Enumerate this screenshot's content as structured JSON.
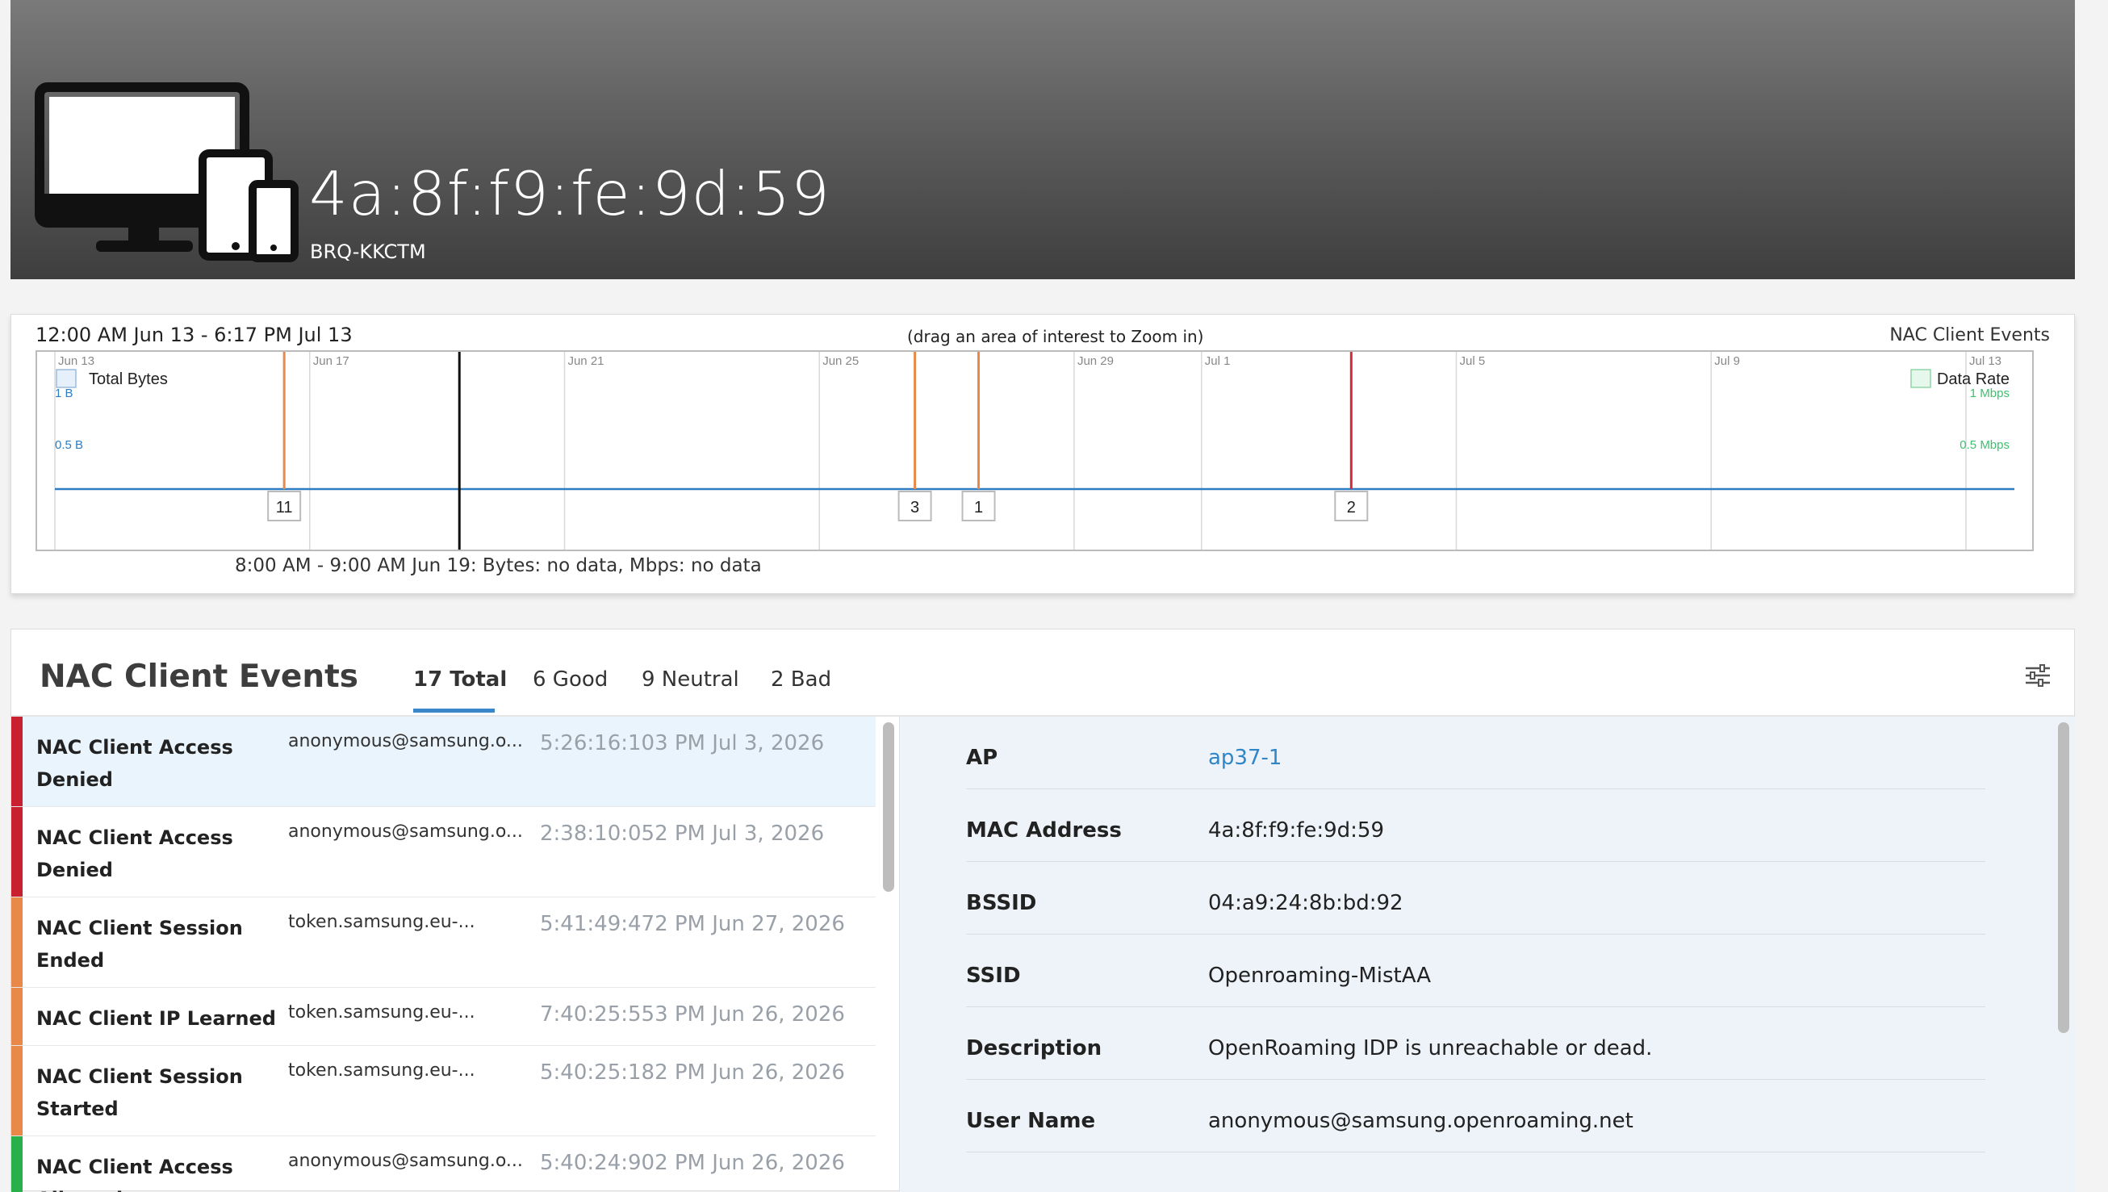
{
  "header": {
    "mac": "4a:8f:f9:fe:9d:59",
    "site": "BRQ-KKCTM"
  },
  "timeline": {
    "range": "12:00 AM Jun 13 - 6:17 PM Jul 13",
    "hint": "(drag an area of interest to Zoom in)",
    "chart_name": "NAC Client Events",
    "hover_readout": "8:00 AM - 9:00 AM Jun 19: Bytes: no data, Mbps: no data"
  },
  "chart_data": {
    "type": "line",
    "x_ticks": [
      "Jun 13",
      "Jun 17",
      "Jun 21",
      "Jun 25",
      "Jun 29",
      "Jul 1",
      "Jul 5",
      "Jul 9",
      "Jul 13"
    ],
    "x_tick_days": [
      0,
      4,
      8,
      12,
      16,
      18,
      22,
      26,
      30
    ],
    "x_range_days": [
      0,
      30.76
    ],
    "series": [
      {
        "name": "Total Bytes",
        "axis": "left",
        "color": "#2e7dc2",
        "values": "no data",
        "level": 0
      },
      {
        "name": "Data Rate",
        "axis": "right",
        "color": "#3fbf6f",
        "values": "no data",
        "level": 0
      }
    ],
    "left_axis": {
      "ticks": [
        "1 B",
        "0.5 B"
      ],
      "color": "#2e7dc2"
    },
    "right_axis": {
      "ticks": [
        "1 Mbps",
        "0.5 Mbps"
      ],
      "color": "#3fbf6f"
    },
    "event_markers": [
      {
        "day": 3.6,
        "count": "11",
        "color": "#e8894a"
      },
      {
        "day": 13.5,
        "count": "3",
        "color": "#e8894a"
      },
      {
        "day": 14.5,
        "count": "1",
        "color": "#e8894a"
      },
      {
        "day": 20.35,
        "count": "2",
        "color": "#d02b3a"
      }
    ],
    "cursor_day": 6.35
  },
  "events": {
    "title": "NAC Client Events",
    "tabs": [
      {
        "label": "17 Total",
        "active": true
      },
      {
        "label": "6 Good"
      },
      {
        "label": "9 Neutral"
      },
      {
        "label": "2 Bad"
      }
    ],
    "items": [
      {
        "type": "NAC Client Access Denied",
        "user": "anonymous@samsung.o...",
        "time": "5:26:16:103 PM Jul 3, 2026",
        "color": "#c8202f"
      },
      {
        "type": "NAC Client Access Denied",
        "user": "anonymous@samsung.o...",
        "time": "2:38:10:052 PM Jul 3, 2026",
        "color": "#c8202f"
      },
      {
        "type": "NAC Client Session Ended",
        "user": "token.samsung.eu-...",
        "time": "5:41:49:472 PM Jun 27, 2026",
        "color": "#e8894a"
      },
      {
        "type": "NAC Client IP Learned",
        "user": "token.samsung.eu-...",
        "time": "7:40:25:553 PM Jun 26, 2026",
        "color": "#e8894a"
      },
      {
        "type": "NAC Client Session Started",
        "user": "token.samsung.eu-...",
        "time": "5:40:25:182 PM Jun 26, 2026",
        "color": "#e8894a"
      },
      {
        "type": "NAC Client Access Allowed",
        "user": "anonymous@samsung.o...",
        "time": "5:40:24:902 PM Jun 26, 2026",
        "color": "#28b04a"
      }
    ]
  },
  "details": {
    "rows": [
      {
        "label": "AP",
        "value": "ap37-1",
        "link": true
      },
      {
        "label": "MAC Address",
        "value": "4a:8f:f9:fe:9d:59"
      },
      {
        "label": "BSSID",
        "value": "04:a9:24:8b:bd:92"
      },
      {
        "label": "SSID",
        "value": "Openroaming-MistAA"
      },
      {
        "label": "Description",
        "value": "OpenRoaming IDP is unreachable or dead."
      },
      {
        "label": "User Name",
        "value": "anonymous@samsung.openroaming.net"
      }
    ]
  }
}
